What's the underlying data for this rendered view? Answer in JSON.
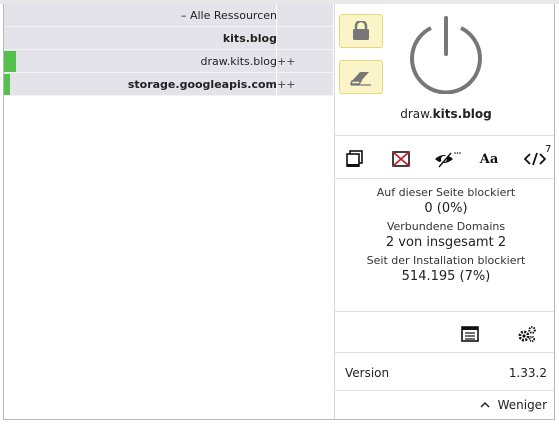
{
  "resources": {
    "all_label": "– Alle Ressourcen",
    "rows": [
      {
        "name": "kits.blog",
        "mark": "",
        "bold": true,
        "bar": 0
      },
      {
        "name": "draw.kits.blog",
        "mark": "++",
        "bold": false,
        "bar": 0.04
      },
      {
        "name": "storage.googleapis.com",
        "mark": "++",
        "bold": true,
        "bar": 0.02
      }
    ]
  },
  "panel": {
    "hostname_sub": "draw.",
    "hostname_domain": "kits.blog",
    "script_count": "7",
    "stats": {
      "blocked_label": "Auf dieser Seite blockiert",
      "blocked_value": "0 (0%)",
      "domains_label": "Verbundene Domains",
      "domains_value": "2 von insgesamt 2",
      "since_label": "Seit der Installation blockiert",
      "since_value": "514.195 (7%)"
    },
    "version_label": "Version",
    "version_value": "1.33.2",
    "less_label": "Weniger"
  },
  "colors": {
    "row_bg": "#e4e3ea",
    "bar_green": "#55c04b",
    "button_bg": "#fbf4c8"
  }
}
